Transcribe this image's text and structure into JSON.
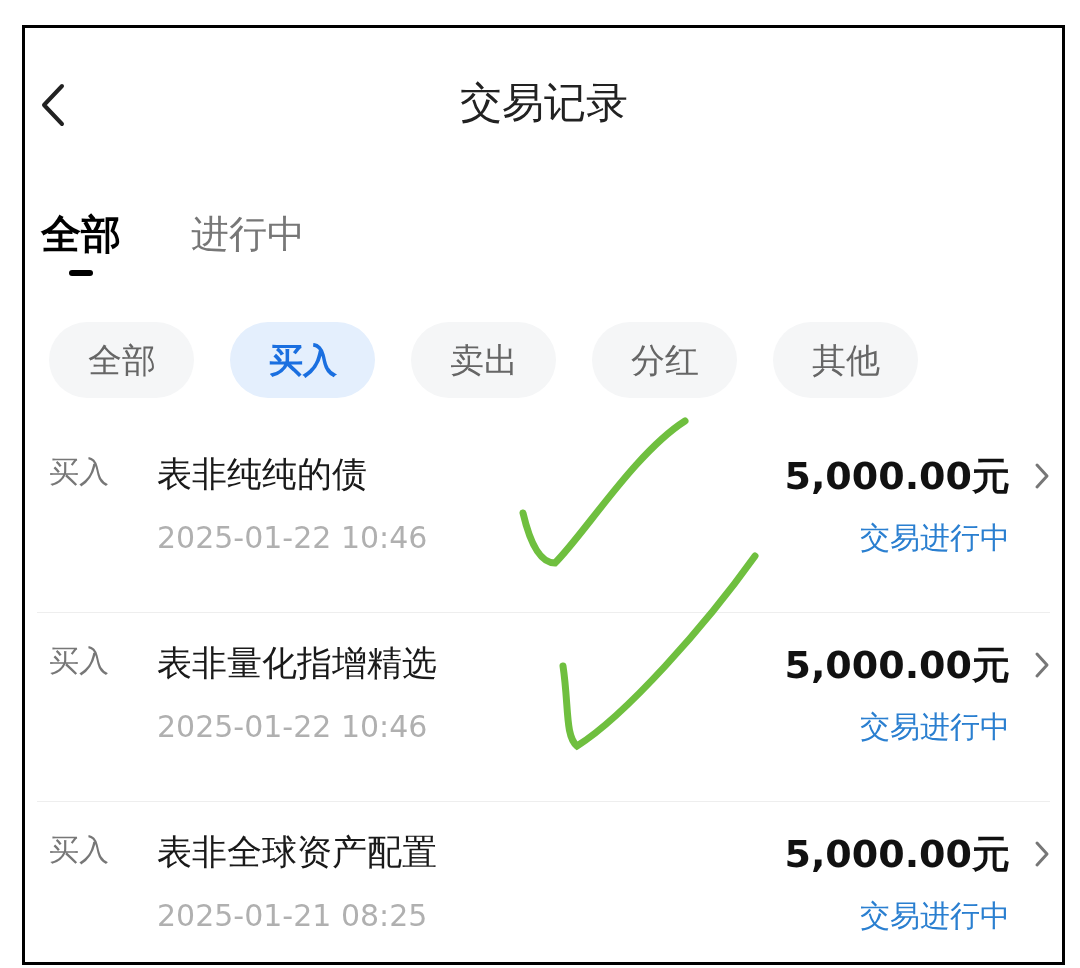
{
  "header": {
    "title": "交易记录"
  },
  "tabs": [
    {
      "label": "全部",
      "selected": true
    },
    {
      "label": "进行中",
      "selected": false
    }
  ],
  "filters": [
    {
      "label": "全部",
      "selected": false
    },
    {
      "label": "买入",
      "selected": true
    },
    {
      "label": "卖出",
      "selected": false
    },
    {
      "label": "分红",
      "selected": false
    },
    {
      "label": "其他",
      "selected": false
    }
  ],
  "records": [
    {
      "type": "买入",
      "name": "表非纯纯的债",
      "time": "2025-01-22 10:46",
      "amount": "5,000.00元",
      "status": "交易进行中"
    },
    {
      "type": "买入",
      "name": "表非量化指增精选",
      "time": "2025-01-22 10:46",
      "amount": "5,000.00元",
      "status": "交易进行中"
    },
    {
      "type": "买入",
      "name": "表非全球资产配置",
      "time": "2025-01-21 08:25",
      "amount": "5,000.00元",
      "status": "交易进行中"
    }
  ]
}
